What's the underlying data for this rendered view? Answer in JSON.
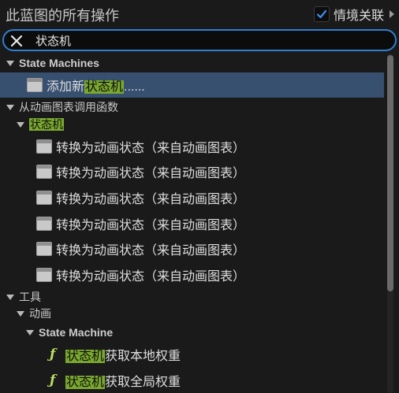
{
  "header": {
    "title": "此蓝图的所有操作",
    "context_label": "情境关联",
    "context_checked": true
  },
  "search": {
    "value": "状态机",
    "placeholder": ""
  },
  "tree": {
    "cat_state_machines": "State Machines",
    "add_new_prefix": "添加新",
    "add_new_highlight": "状态机",
    "add_new_suffix": "......",
    "cat_call_from_anim": "从动画图表调用函数",
    "sub_state_machine_highlight": "状态机",
    "convert_items": [
      "转换为动画状态（来自动画图表）",
      "转换为动画状态（来自动画图表）",
      "转换为动画状态（来自动画图表）",
      "转换为动画状态（来自动画图表）",
      "转换为动画状态（来自动画图表）",
      "转换为动画状态（来自动画图表）"
    ],
    "cat_tools": "工具",
    "cat_animation": "动画",
    "cat_state_machine": "State Machine",
    "func_items": [
      {
        "highlight": "状态机",
        "suffix": "获取本地权重"
      },
      {
        "highlight": "状态机",
        "suffix": "获取全局权重"
      }
    ]
  },
  "icons": {
    "clear": "close-icon",
    "check": "checkmark-icon",
    "node": "node-icon",
    "function": "function-icon"
  },
  "colors": {
    "accent": "#2f7fd1",
    "highlight": "#7aa82f",
    "selected_row": "#37506f",
    "function_icon": "#b9de62"
  }
}
